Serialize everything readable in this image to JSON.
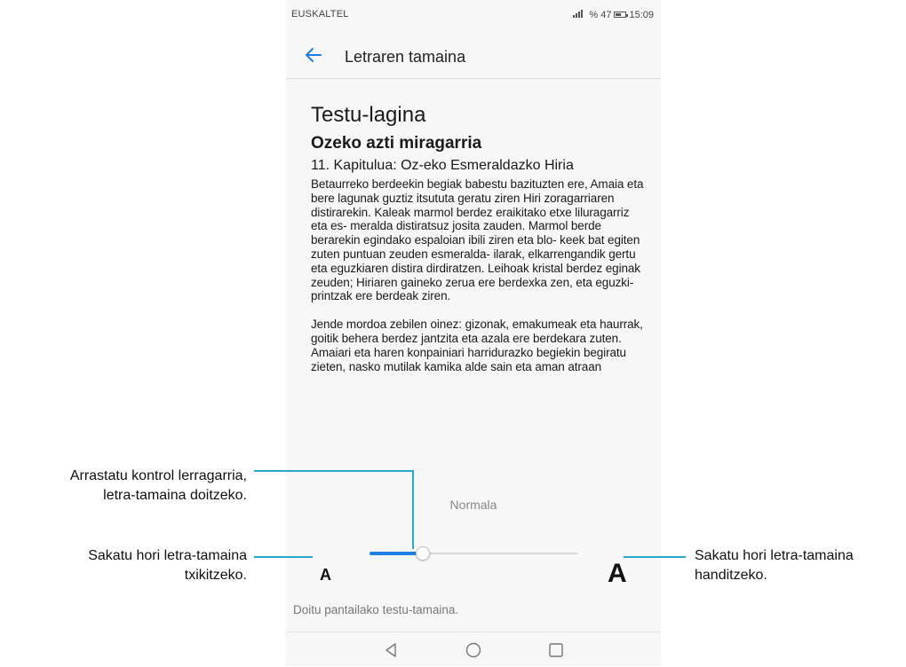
{
  "status_bar": {
    "carrier": "EUSKALTEL",
    "battery": "% 47",
    "time": "15:09"
  },
  "header": {
    "title": "Letraren tamaina",
    "back_icon": "arrow-left-icon"
  },
  "sample": {
    "heading": "Testu-lagina",
    "book_title": "Ozeko azti miragarria",
    "chapter": "11. Kapitulua: Oz-eko Esmeraldazko Hiria",
    "paragraph_1": "Betaurreko berdeekin begiak babestu bazituzten ere, Amaia eta bere lagunak guztiz itsututa geratu ziren Hiri zoragarriaren distirarekin. Kaleak marmol berdez eraikitako etxe liluragarriz eta es- meralda distiratsuz josita zauden. Marmol berde berarekin egindako espaloian ibili ziren eta blo- keek bat egiten zuten puntuan zeuden esmeralda- ilarak, elkarrengandik gertu eta eguzkiaren distira dirdiratzen. Leihoak kristal berdez eginak zeuden; Hiriaren gaineko zerua ere berdexka zen, eta eguzki-printzak ere berdeak ziren.",
    "paragraph_2": "Jende mordoa zebilen oinez: gizonak, emakumeak eta haurrak, goitik behera berdez jantzita eta azala ere berdekara zuten. Amaiari eta haren konpainiari harridurazko begiekin begiratu zieten, nasko mutilak kamika alde sain eta aman atraan"
  },
  "font_size": {
    "current_label": "Normala",
    "small_label": "A",
    "large_label": "A",
    "level": 0.25,
    "accent_color": "#1f7fe0"
  },
  "hint": "Doitu pantailako testu-tamaina.",
  "nav": {
    "back_icon": "triangle-back-icon",
    "home_icon": "circle-home-icon",
    "recents_icon": "square-recents-icon"
  },
  "callouts": {
    "slider_line1": "Arrastatu kontrol lerragarria,",
    "slider_line2": "letra-tamaina doitzeko.",
    "small_line1": "Sakatu hori letra-tamaina",
    "small_line2": "txikitzeko.",
    "large_line1": "Sakatu hori letra-tamaina",
    "large_line2": "handitzeko.",
    "line_color": "#29a9c9"
  }
}
